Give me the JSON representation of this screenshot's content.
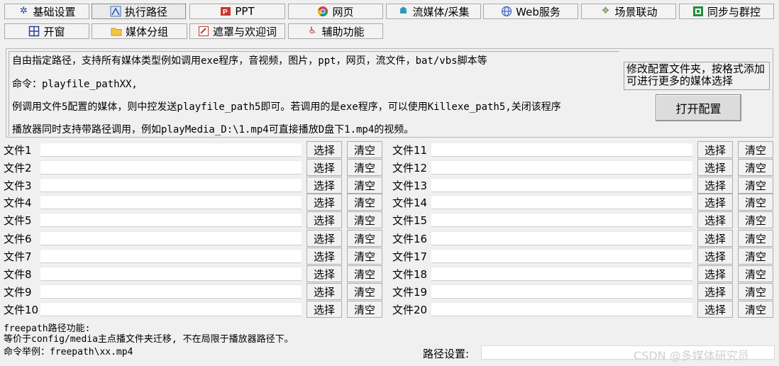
{
  "tabs_row1": [
    {
      "label": "基础设置",
      "icon": "gear-icon"
    },
    {
      "label": "执行路径",
      "icon": "path-icon",
      "active": true
    },
    {
      "label": "PPT",
      "icon": "ppt-icon"
    },
    {
      "label": "网页",
      "icon": "chrome-icon"
    },
    {
      "label": "流媒体/采集",
      "icon": "stream-icon"
    },
    {
      "label": "Web服务",
      "icon": "globe-icon"
    },
    {
      "label": "场景联动",
      "icon": "handshake-icon"
    },
    {
      "label": "同步与群控",
      "icon": "sync-icon"
    }
  ],
  "tabs_row2": [
    {
      "label": "开窗",
      "icon": "window-grid-icon"
    },
    {
      "label": "媒体分组",
      "icon": "folder-icon"
    },
    {
      "label": "遮罩与欢迎词",
      "icon": "mask-icon"
    },
    {
      "label": "辅助功能",
      "icon": "accessibility-icon"
    }
  ],
  "description": {
    "line1": "自由指定路径，支持所有媒体类型例如调用exe程序，音视频，图片，ppt，网页，流文件，bat/vbs脚本等",
    "line2": "命令：playfile_pathXX,",
    "line3": "例调用文件5配置的媒体，则中控发送playfile_path5即可。若调用的是exe程序，可以使用Killexe_path5,关闭该程序",
    "line4": "播放器同时支持带路径调用，例如playMedia_D:\\1.mp4可直接播放D盘下1.mp4的视频。"
  },
  "config": {
    "hint": "修改配置文件夹，按格式添加可进行更多的媒体选择",
    "open_button": "打开配置"
  },
  "select_label": "选择",
  "clear_label": "清空",
  "files_left": [
    {
      "label": "文件1",
      "value": ""
    },
    {
      "label": "文件2",
      "value": ""
    },
    {
      "label": "文件3",
      "value": ""
    },
    {
      "label": "文件4",
      "value": ""
    },
    {
      "label": "文件5",
      "value": ""
    },
    {
      "label": "文件6",
      "value": ""
    },
    {
      "label": "文件7",
      "value": ""
    },
    {
      "label": "文件8",
      "value": ""
    },
    {
      "label": "文件9",
      "value": ""
    },
    {
      "label": "文件10",
      "value": ""
    }
  ],
  "files_right": [
    {
      "label": "文件11",
      "value": ""
    },
    {
      "label": "文件12",
      "value": ""
    },
    {
      "label": "文件13",
      "value": ""
    },
    {
      "label": "文件14",
      "value": ""
    },
    {
      "label": "文件15",
      "value": ""
    },
    {
      "label": "文件16",
      "value": ""
    },
    {
      "label": "文件17",
      "value": ""
    },
    {
      "label": "文件18",
      "value": ""
    },
    {
      "label": "文件19",
      "value": ""
    },
    {
      "label": "文件20",
      "value": ""
    }
  ],
  "freepath": {
    "line1": "freepath路径功能:",
    "line2": "等价于config/media主点播文件夹迁移, 不在局限于播放器路径下。",
    "line3": "命令举例：freepath\\xx.mp4"
  },
  "path_setting": {
    "label": "路径设置:",
    "value": ""
  },
  "watermark": "CSDN @多媒体研究员",
  "colors": {
    "background": "#f0f0f0",
    "input": "#ffffff",
    "button": "#f2f2f2",
    "open_button": "#dcdcdc"
  }
}
